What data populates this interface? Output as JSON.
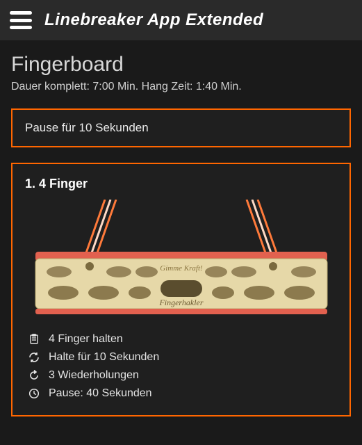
{
  "header": {
    "title": "Linebreaker App Extended"
  },
  "page": {
    "title": "Fingerboard",
    "subtitle": "Dauer komplett: 7:00 Min. Hang Zeit: 1:40 Min."
  },
  "pause_card": {
    "text": "Pause für 10 Sekunden"
  },
  "exercise": {
    "title": "1. 4 Finger",
    "board": {
      "brand_top": "Gimme Kraft!",
      "brand_bottom": "Fingerhakler"
    },
    "details": [
      {
        "icon": "clipboard-icon",
        "text": "4 Finger halten"
      },
      {
        "icon": "refresh-icon",
        "text": "Halte für 10 Sekunden"
      },
      {
        "icon": "repeat-icon",
        "text": "3 Wiederholungen"
      },
      {
        "icon": "clock-icon",
        "text": "Pause: 40 Sekunden"
      }
    ]
  },
  "colors": {
    "accent": "#ff6600",
    "board_wood": "#e6d8a8",
    "board_trim": "#e2614f",
    "rope": "#ff7a3a"
  }
}
